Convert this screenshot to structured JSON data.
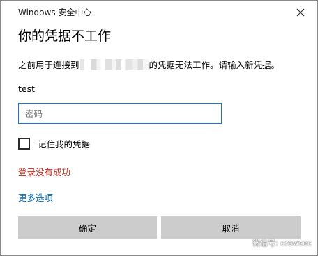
{
  "window": {
    "title": "Windows 安全中心",
    "close_icon": "close-icon"
  },
  "dialog": {
    "heading": "你的凭据不工作",
    "message_prefix": "之前用于连接到",
    "message_suffix": "的凭据无法工作。请输入新凭据。",
    "username": "test",
    "password_placeholder": "密码",
    "password_value": "",
    "remember_label": "记住我的凭据",
    "remember_checked": false,
    "error_text": "登录没有成功",
    "more_options_label": "更多选项"
  },
  "buttons": {
    "ok_label": "确定",
    "cancel_label": "取消"
  },
  "watermark": {
    "text": "微信号: crowsec",
    "icon": "wechat-icon"
  },
  "colors": {
    "accent_border": "#1f75c9",
    "error": "#c42b1c",
    "link": "#0067b8",
    "button_bg": "#cccccc"
  }
}
